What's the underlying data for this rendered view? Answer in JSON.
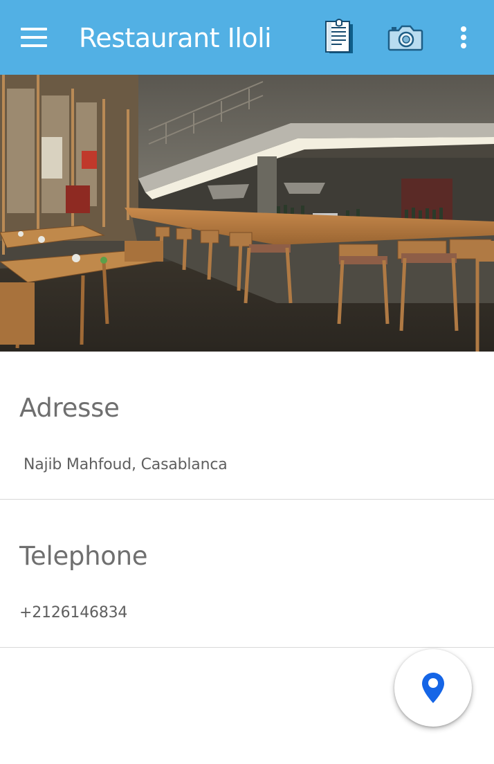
{
  "appbar": {
    "title": "Restaurant Iloli",
    "menu_icon": "hamburger-menu-icon",
    "notes_icon": "notes-document-icon",
    "camera_icon": "camera-icon",
    "overflow_icon": "more-vertical-icon",
    "background_color": "#52b0e4"
  },
  "hero": {
    "image": "restaurant-interior-photo"
  },
  "address": {
    "label": "Adresse",
    "value": "Najib Mahfoud, Casablanca"
  },
  "telephone": {
    "label": "Telephone",
    "value": "+2126146834"
  },
  "fab": {
    "icon": "map-pin-icon",
    "icon_color": "#1565e6"
  }
}
